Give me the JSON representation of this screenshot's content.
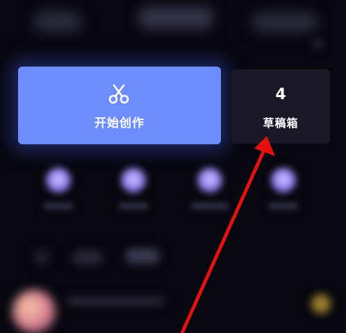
{
  "start_card": {
    "label": "开始创作",
    "icon": "scissors-icon",
    "color": "#6c8dfa"
  },
  "drafts_card": {
    "count": "4",
    "label": "草稿箱",
    "color": "#181827"
  },
  "annotation": {
    "arrow_color": "#e3120e"
  }
}
